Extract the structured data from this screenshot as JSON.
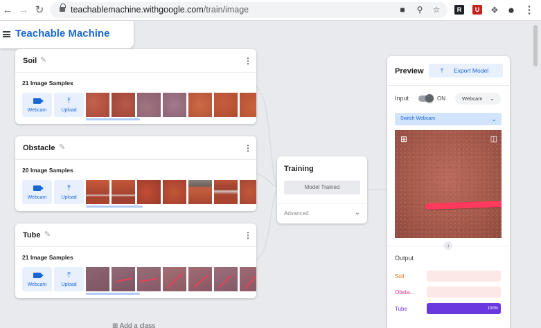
{
  "browser": {
    "url_domain": "teachablemachine.withgoogle.com",
    "url_path": "/train/image",
    "icons": [
      "back-icon",
      "forward-icon",
      "reload-icon",
      "lock-icon",
      "camera-icon",
      "zoom-icon",
      "star-icon",
      "extension-icon",
      "puzzle-icon",
      "profile-icon",
      "menu-icon"
    ]
  },
  "app": {
    "title": "Teachable Machine",
    "brand_color": "#1967d2"
  },
  "classes": [
    {
      "name": "Soil",
      "samples": "21 Image Samples",
      "webcam_label": "Webcam",
      "upload_label": "Upload"
    },
    {
      "name": "Obstacle",
      "samples": "20 Image Samples",
      "webcam_label": "Webcam",
      "upload_label": "Upload"
    },
    {
      "name": "Tube",
      "samples": "21 Image Samples",
      "webcam_label": "Webcam",
      "upload_label": "Upload"
    }
  ],
  "add_class": "Add a class",
  "training": {
    "title": "Training",
    "button": "Model Trained",
    "advanced": "Advanced"
  },
  "preview": {
    "title": "Preview",
    "export": "Export Model",
    "input_label": "Input",
    "toggle_state": "ON",
    "source": "Webcam",
    "switch_webcam": "Switch Webcam",
    "output_label": "Output",
    "outputs": [
      {
        "label": "Soil",
        "percent": 0,
        "percent_text": "",
        "color": "#e8710a",
        "track": "#fce8e6"
      },
      {
        "label": "Obsta...",
        "percent": 0,
        "percent_text": "",
        "color": "#d93080",
        "track": "#fce8e6"
      },
      {
        "label": "Tube",
        "percent": 100,
        "percent_text": "100%",
        "color": "#6b38e0",
        "track": "#ede7fb"
      }
    ]
  }
}
